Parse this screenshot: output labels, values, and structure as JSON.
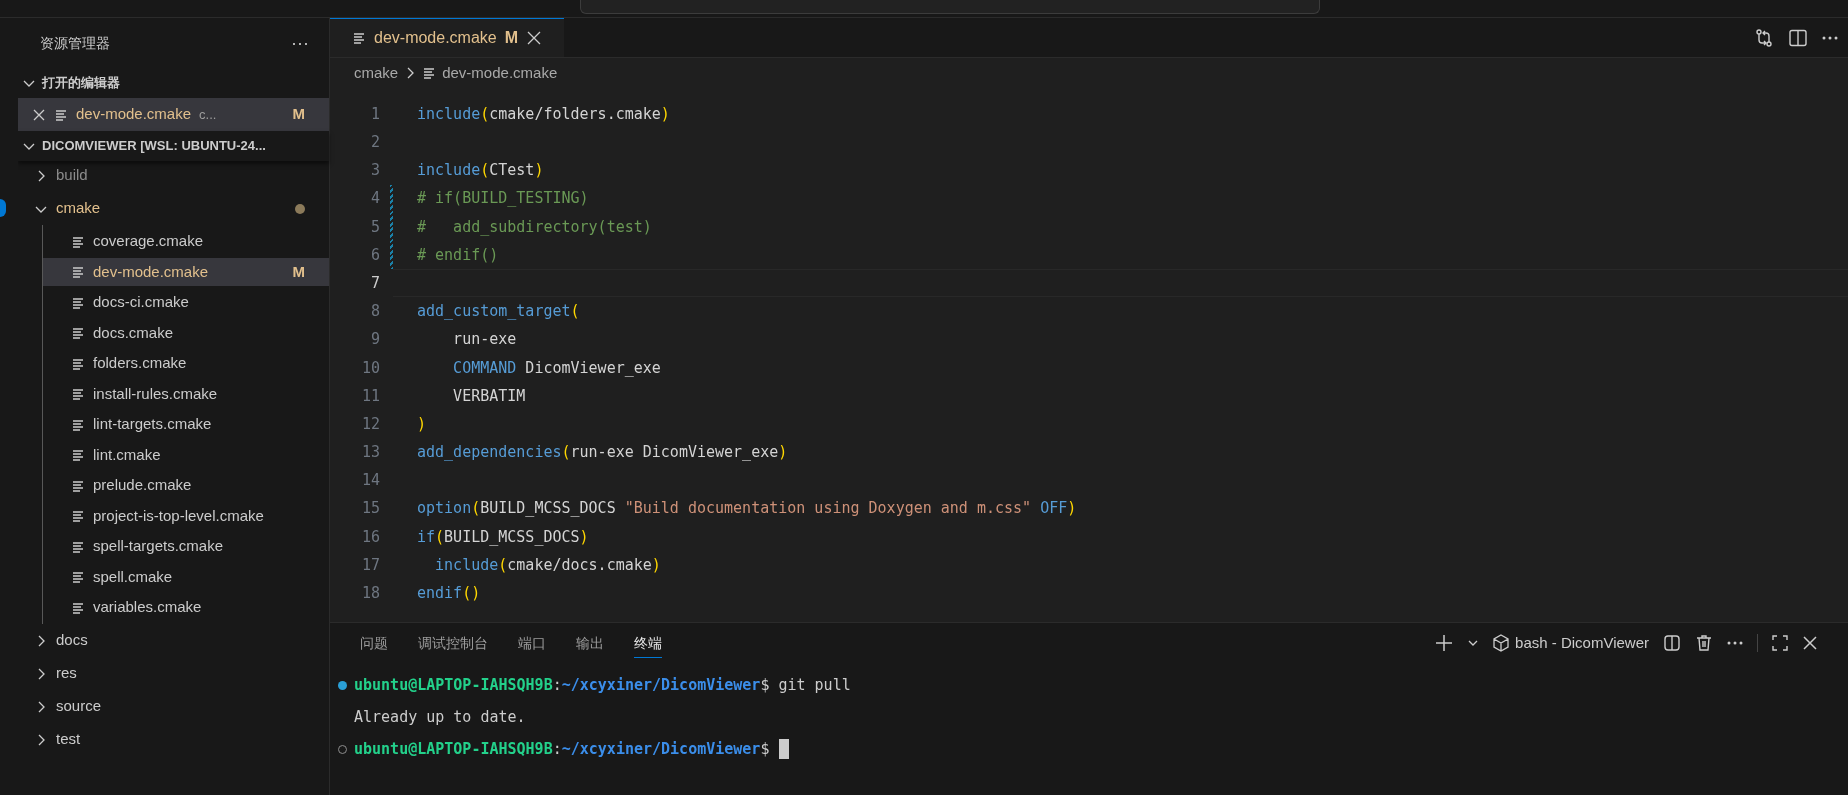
{
  "sidebar": {
    "title": "资源管理器",
    "more": "···",
    "open_editors": {
      "label": "打开的编辑器",
      "expanded": true,
      "items": [
        {
          "name": "dev-mode.cmake",
          "description": "c...",
          "badge": "M",
          "selected": true
        }
      ]
    },
    "workspace": {
      "label": "DICOMVIEWER [WSL: UBUNTU-24...",
      "expanded": true,
      "children": [
        {
          "name": "build",
          "kind": "folder",
          "expanded": false,
          "ignored": true,
          "selected": false
        },
        {
          "name": "cmake",
          "kind": "folder",
          "expanded": true,
          "modified_dot": true,
          "ignored": false,
          "selected": false,
          "children": [
            {
              "name": "coverage.cmake",
              "kind": "file",
              "selected": false
            },
            {
              "name": "dev-mode.cmake",
              "kind": "file",
              "badge": "M",
              "selected": true
            },
            {
              "name": "docs-ci.cmake",
              "kind": "file",
              "selected": false
            },
            {
              "name": "docs.cmake",
              "kind": "file",
              "selected": false
            },
            {
              "name": "folders.cmake",
              "kind": "file",
              "selected": false
            },
            {
              "name": "install-rules.cmake",
              "kind": "file",
              "selected": false
            },
            {
              "name": "lint-targets.cmake",
              "kind": "file",
              "selected": false
            },
            {
              "name": "lint.cmake",
              "kind": "file",
              "selected": false
            },
            {
              "name": "prelude.cmake",
              "kind": "file",
              "selected": false
            },
            {
              "name": "project-is-top-level.cmake",
              "kind": "file",
              "selected": false
            },
            {
              "name": "spell-targets.cmake",
              "kind": "file",
              "selected": false
            },
            {
              "name": "spell.cmake",
              "kind": "file",
              "selected": false
            },
            {
              "name": "variables.cmake",
              "kind": "file",
              "selected": false
            }
          ]
        },
        {
          "name": "docs",
          "kind": "folder",
          "expanded": false,
          "ignored": false,
          "selected": false
        },
        {
          "name": "res",
          "kind": "folder",
          "expanded": false,
          "ignored": false,
          "selected": false
        },
        {
          "name": "source",
          "kind": "folder",
          "expanded": false,
          "ignored": false,
          "selected": false
        },
        {
          "name": "test",
          "kind": "folder",
          "expanded": false,
          "ignored": false,
          "selected": false
        }
      ]
    }
  },
  "editor": {
    "tabs": [
      {
        "label": "dev-mode.cmake",
        "badge": "M",
        "selected": true
      }
    ],
    "breadcrumb": [
      "cmake",
      "dev-mode.cmake"
    ],
    "lines": [
      {
        "number": "1",
        "tokens": [
          {
            "kind": "function",
            "text": "include"
          },
          {
            "kind": "paren",
            "text": "("
          },
          {
            "kind": "plain",
            "text": "cmake/folders.cmake"
          },
          {
            "kind": "paren",
            "text": ")"
          }
        ]
      },
      {
        "number": "2"
      },
      {
        "number": "3",
        "tokens": [
          {
            "kind": "function",
            "text": "include"
          },
          {
            "kind": "paren",
            "text": "("
          },
          {
            "kind": "plain",
            "text": "CTest"
          },
          {
            "kind": "paren",
            "text": ")"
          }
        ]
      },
      {
        "number": "4",
        "modified": true,
        "tokens": [
          {
            "kind": "comment",
            "text": "# if(BUILD_TESTING)"
          }
        ]
      },
      {
        "number": "5",
        "modified": true,
        "tokens": [
          {
            "kind": "comment",
            "text": "#   add_subdirectory(test)"
          }
        ]
      },
      {
        "number": "6",
        "modified": true,
        "tokens": [
          {
            "kind": "comment",
            "text": "# endif()"
          }
        ]
      },
      {
        "number": "7",
        "current": true
      },
      {
        "number": "8",
        "tokens": [
          {
            "kind": "function",
            "text": "add_custom_target"
          },
          {
            "kind": "paren",
            "text": "("
          }
        ]
      },
      {
        "number": "9",
        "tokens": [
          {
            "kind": "plain",
            "text": "    run-exe"
          }
        ]
      },
      {
        "number": "10",
        "tokens": [
          {
            "kind": "keyword",
            "text": "    COMMAND"
          },
          {
            "kind": "plain",
            "text": " DicomViewer_exe"
          }
        ]
      },
      {
        "number": "11",
        "tokens": [
          {
            "kind": "plain",
            "text": "    VERBATIM"
          }
        ]
      },
      {
        "number": "12",
        "tokens": [
          {
            "kind": "paren",
            "text": ")"
          }
        ]
      },
      {
        "number": "13",
        "tokens": [
          {
            "kind": "function",
            "text": "add_dependencies"
          },
          {
            "kind": "paren",
            "text": "("
          },
          {
            "kind": "plain",
            "text": "run-exe DicomViewer_exe"
          },
          {
            "kind": "paren",
            "text": ")"
          }
        ]
      },
      {
        "number": "14"
      },
      {
        "number": "15",
        "tokens": [
          {
            "kind": "function",
            "text": "option"
          },
          {
            "kind": "paren",
            "text": "("
          },
          {
            "kind": "plain",
            "text": "BUILD_MCSS_DOCS "
          },
          {
            "kind": "string",
            "text": "\"Build documentation using Doxygen and m.css\""
          },
          {
            "kind": "keyword",
            "text": " OFF"
          },
          {
            "kind": "paren",
            "text": ")"
          }
        ]
      },
      {
        "number": "16",
        "tokens": [
          {
            "kind": "function",
            "text": "if"
          },
          {
            "kind": "paren",
            "text": "("
          },
          {
            "kind": "plain",
            "text": "BUILD_MCSS_DOCS"
          },
          {
            "kind": "paren",
            "text": ")"
          }
        ]
      },
      {
        "number": "17",
        "tokens": [
          {
            "kind": "function",
            "text": "  include"
          },
          {
            "kind": "paren",
            "text": "("
          },
          {
            "kind": "plain",
            "text": "cmake/docs.cmake"
          },
          {
            "kind": "paren",
            "text": ")"
          }
        ]
      },
      {
        "number": "18",
        "tokens": [
          {
            "kind": "function",
            "text": "endif"
          },
          {
            "kind": "paren",
            "text": "()"
          }
        ]
      }
    ]
  },
  "panel": {
    "tabs": [
      {
        "label": "问题",
        "selected": false
      },
      {
        "label": "调试控制台",
        "selected": false
      },
      {
        "label": "端口",
        "selected": false
      },
      {
        "label": "输出",
        "selected": false
      },
      {
        "label": "终端",
        "selected": true
      }
    ],
    "terminal_name": "bash - DicomViewer",
    "lines": [
      {
        "kind": "prompt",
        "succeeded": true,
        "user": "ubuntu@LAPTOP-IAHSQH9B",
        "sep": ":",
        "path": "~/xcyxiner/DicomViewer",
        "command": "$ git pull"
      },
      {
        "kind": "output",
        "text": "Already up to date."
      },
      {
        "kind": "prompt",
        "succeeded": false,
        "cursor": true,
        "user": "ubuntu@LAPTOP-IAHSQH9B",
        "sep": ":",
        "path": "~/xcyxiner/DicomViewer",
        "command": "$"
      }
    ]
  }
}
